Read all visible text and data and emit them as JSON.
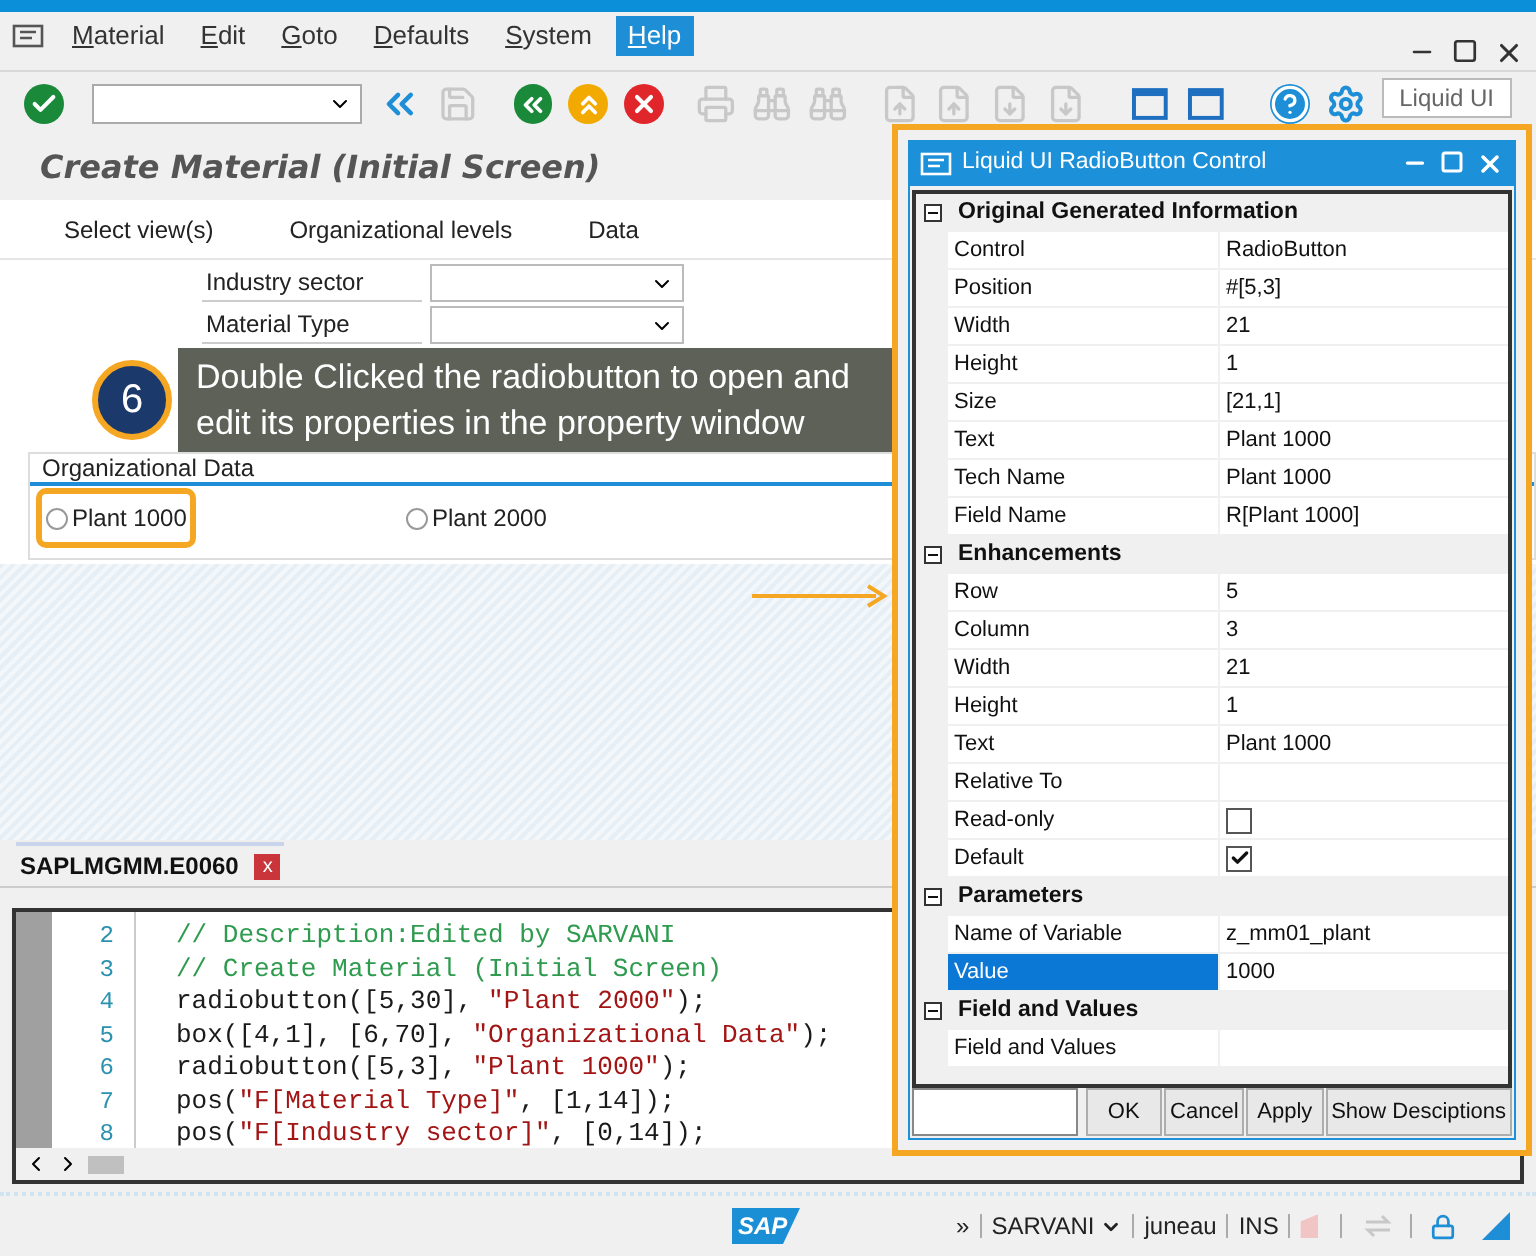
{
  "window": {
    "menu": [
      {
        "label": "Material",
        "selected": false
      },
      {
        "label": "Edit",
        "selected": false
      },
      {
        "label": "Goto",
        "selected": false
      },
      {
        "label": "Defaults",
        "selected": false
      },
      {
        "label": "System",
        "selected": false
      },
      {
        "label": "Help",
        "selected": true
      }
    ]
  },
  "toolbar": {
    "liquid_ui_button": "Liquid UI"
  },
  "page": {
    "title": "Create Material (Initial Screen)",
    "actions": [
      "Select view(s)",
      "Organizational levels",
      "Data"
    ],
    "fields": [
      {
        "label": "Industry sector"
      },
      {
        "label": "Material Type"
      }
    ],
    "group": {
      "title": "Organizational Data",
      "radios": [
        {
          "label": "Plant 1000",
          "selected": false,
          "highlighted": true
        },
        {
          "label": "Plant 2000",
          "selected": false,
          "highlighted": false
        }
      ]
    }
  },
  "callout": {
    "number": "6",
    "text": "Double Clicked the radiobutton to open and edit its properties in the property window"
  },
  "editor": {
    "tab": "SAPLMGMM.E0060",
    "close": "x",
    "lines": [
      {
        "number": "2",
        "segments": [
          {
            "kind": "comment",
            "text": "// Description:Edited by SARVANI"
          }
        ]
      },
      {
        "number": "3",
        "segments": [
          {
            "kind": "comment",
            "text": "// Create Material (Initial Screen)"
          }
        ]
      },
      {
        "number": "4",
        "segments": [
          {
            "kind": "plain",
            "text": "radiobutton([5,30], "
          },
          {
            "kind": "string",
            "text": "\"Plant 2000\""
          },
          {
            "kind": "plain",
            "text": ");"
          }
        ]
      },
      {
        "number": "5",
        "segments": [
          {
            "kind": "plain",
            "text": "box([4,1], [6,70], "
          },
          {
            "kind": "string",
            "text": "\"Organizational Data\""
          },
          {
            "kind": "plain",
            "text": ");"
          }
        ]
      },
      {
        "number": "6",
        "segments": [
          {
            "kind": "plain",
            "text": "radiobutton([5,3], "
          },
          {
            "kind": "string",
            "text": "\"Plant 1000\""
          },
          {
            "kind": "plain",
            "text": ");"
          }
        ]
      },
      {
        "number": "7",
        "segments": [
          {
            "kind": "plain",
            "text": "pos("
          },
          {
            "kind": "string",
            "text": "\"F[Material Type]\""
          },
          {
            "kind": "plain",
            "text": ", [1,14]);"
          }
        ]
      },
      {
        "number": "8",
        "segments": [
          {
            "kind": "plain",
            "text": "pos("
          },
          {
            "kind": "string",
            "text": "\"F[Industry sector]\""
          },
          {
            "kind": "plain",
            "text": ", [0,14]);"
          }
        ]
      }
    ]
  },
  "property_window": {
    "title": "Liquid UI RadioButton Control",
    "sections": [
      {
        "title": "Original Generated Information",
        "expanded": true,
        "rows": [
          {
            "kind": "text",
            "label": "Control",
            "value": "RadioButton",
            "selected": false
          },
          {
            "kind": "text",
            "label": "Position",
            "value": "#[5,3]",
            "selected": false
          },
          {
            "kind": "text",
            "label": "Width",
            "value": "21",
            "selected": false
          },
          {
            "kind": "text",
            "label": "Height",
            "value": "1",
            "selected": false
          },
          {
            "kind": "text",
            "label": "Size",
            "value": "[21,1]",
            "selected": false
          },
          {
            "kind": "text",
            "label": "Text",
            "value": "Plant 1000",
            "selected": false
          },
          {
            "kind": "text",
            "label": "Tech Name",
            "value": "Plant 1000",
            "selected": false
          },
          {
            "kind": "text",
            "label": "Field Name",
            "value": "R[Plant 1000]",
            "selected": false
          }
        ]
      },
      {
        "title": "Enhancements",
        "expanded": true,
        "rows": [
          {
            "kind": "text",
            "label": "Row",
            "value": "5",
            "selected": false
          },
          {
            "kind": "text",
            "label": "Column",
            "value": "3",
            "selected": false
          },
          {
            "kind": "text",
            "label": "Width",
            "value": "21",
            "selected": false
          },
          {
            "kind": "text",
            "label": "Height",
            "value": "1",
            "selected": false
          },
          {
            "kind": "text",
            "label": "Text",
            "value": "Plant 1000",
            "selected": false
          },
          {
            "kind": "text",
            "label": "Relative To",
            "selected": false
          },
          {
            "kind": "checkbox",
            "label": "Read-only",
            "checked": false,
            "selected": false
          },
          {
            "kind": "checkbox",
            "label": "Default",
            "checked": true,
            "selected": false
          }
        ]
      },
      {
        "title": "Parameters",
        "expanded": true,
        "rows": [
          {
            "kind": "text",
            "label": "Name of Variable",
            "value": "z_mm01_plant",
            "selected": false
          },
          {
            "kind": "text",
            "label": "Value",
            "value": "1000",
            "selected": true
          }
        ]
      },
      {
        "title": "Field and Values",
        "expanded": true,
        "rows": [
          {
            "kind": "text",
            "label": "Field and Values",
            "selected": false
          }
        ]
      }
    ],
    "buttons": [
      "OK",
      "Cancel",
      "Apply",
      "Show Desciptions"
    ]
  },
  "status_bar": {
    "logo": "SAP",
    "items": [
      {
        "text": "»",
        "dropdown": false
      },
      {
        "text": "SARVANI",
        "dropdown": true
      },
      {
        "text": "juneau",
        "dropdown": false
      },
      {
        "text": "INS",
        "dropdown": false
      }
    ]
  }
}
